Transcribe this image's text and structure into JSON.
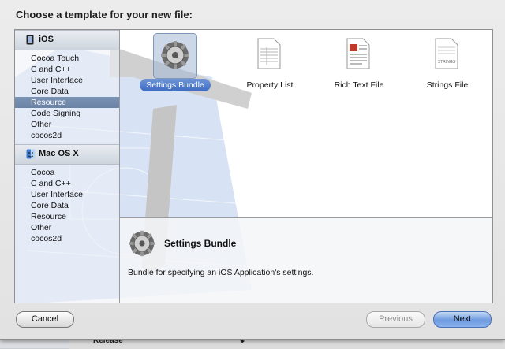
{
  "dialog": {
    "title": "Choose a template for your new file:"
  },
  "sidebar": {
    "sections": [
      {
        "title": "iOS",
        "icon": "iphone-icon",
        "items": [
          "Cocoa Touch",
          "C and C++",
          "User Interface",
          "Core Data",
          "Resource",
          "Code Signing",
          "Other",
          "cocos2d"
        ],
        "selected": "Resource"
      },
      {
        "title": "Mac OS X",
        "icon": "mac-os-icon",
        "items": [
          "Cocoa",
          "C and C++",
          "User Interface",
          "Core Data",
          "Resource",
          "Other",
          "cocos2d"
        ]
      }
    ]
  },
  "templates": [
    {
      "label": "Settings Bundle",
      "icon": "settings-bundle-icon",
      "selected": true
    },
    {
      "label": "Property List",
      "icon": "property-list-icon"
    },
    {
      "label": "Rich Text File",
      "icon": "rich-text-file-icon"
    },
    {
      "label": "Strings File",
      "icon": "strings-file-icon",
      "badge": "STRINGS"
    }
  ],
  "description": {
    "name": "Settings Bundle",
    "text": "Bundle for specifying an iOS Application's settings."
  },
  "buttons": {
    "cancel": "Cancel",
    "previous": "Previous",
    "next": "Next"
  },
  "background": {
    "release_label": "Release"
  },
  "colors": {
    "selection": "#6a83a6",
    "accent_blue": "#3d6bc2"
  }
}
